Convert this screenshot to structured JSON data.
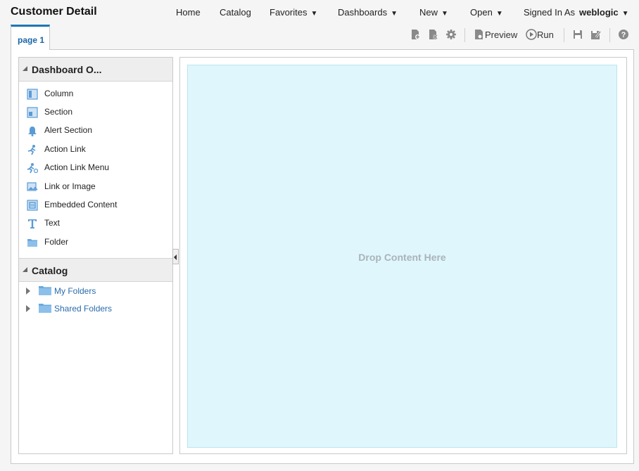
{
  "app": {
    "title": "Customer Detail"
  },
  "nav": {
    "home": "Home",
    "catalog": "Catalog",
    "favorites": "Favorites",
    "dashboards": "Dashboards",
    "new": "New",
    "open": "Open",
    "signed_in_label": "Signed In As",
    "user": "weblogic",
    "caret": "▼"
  },
  "tabs": [
    {
      "label": "page 1"
    }
  ],
  "toolbar": {
    "preview": "Preview",
    "run": "Run",
    "icons": [
      "add-page-icon",
      "delete-page-icon",
      "settings-gear-icon",
      "preview-icon",
      "run-icon",
      "save-icon",
      "save-as-icon",
      "help-icon"
    ]
  },
  "dashboard_objects": {
    "title": "Dashboard O...",
    "items": [
      {
        "label": "Column",
        "icon": "column-icon"
      },
      {
        "label": "Section",
        "icon": "section-icon"
      },
      {
        "label": "Alert Section",
        "icon": "bell-icon"
      },
      {
        "label": "Action Link",
        "icon": "action-link-icon"
      },
      {
        "label": "Action Link Menu",
        "icon": "action-link-menu-icon"
      },
      {
        "label": "Link or Image",
        "icon": "link-image-icon"
      },
      {
        "label": "Embedded Content",
        "icon": "embedded-content-icon"
      },
      {
        "label": "Text",
        "icon": "text-icon"
      },
      {
        "label": "Folder",
        "icon": "folder-icon"
      }
    ]
  },
  "catalog": {
    "title": "Catalog",
    "items": [
      {
        "label": "My Folders",
        "icon": "folder-icon"
      },
      {
        "label": "Shared Folders",
        "icon": "folder-icon"
      }
    ]
  },
  "canvas": {
    "drop_text": "Drop Content Here"
  },
  "colors": {
    "accent": "#1a76b8",
    "link": "#2a6bab",
    "dropzone": "#dff6fc",
    "icon_blue": "#5a9bd4"
  }
}
